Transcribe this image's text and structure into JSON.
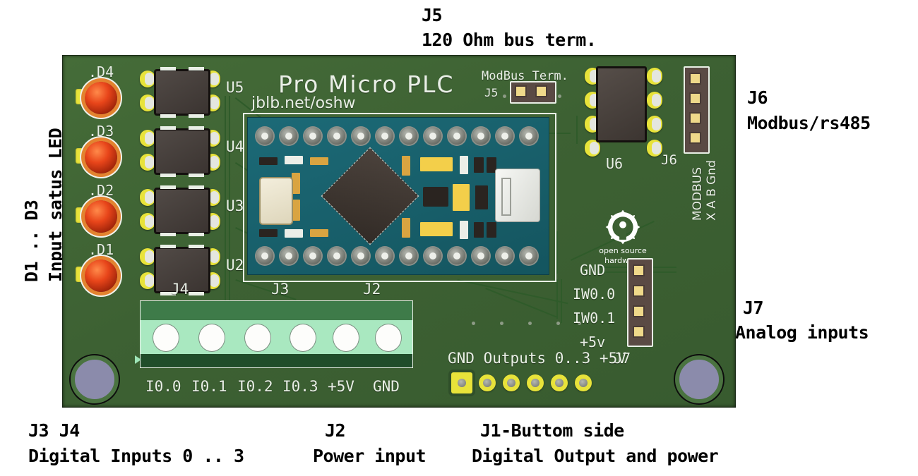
{
  "annotations": {
    "top": {
      "title": "J5",
      "desc": "120 Ohm bus term."
    },
    "left_vertical": {
      "line1": "D1 .. D3",
      "line2": "Input satus LED"
    },
    "right_top": {
      "title": "J6",
      "desc": "Modbus/rs485"
    },
    "right_bottom": {
      "title": "J7",
      "desc": "Analog inputs"
    },
    "bottom": {
      "j3j4_title": "J3 J4",
      "j3j4_desc": "Digital Inputs 0 .. 3",
      "j2_title": "J2",
      "j2_desc": "Power input",
      "j1_title": "J1-Buttom side",
      "j1_desc": "Digital Output and power"
    }
  },
  "board": {
    "brand": "Pro Micro PLC",
    "url": "jblb.net/oshw",
    "modbus_term_label": "ModBus Term.",
    "j5_label": "J5",
    "leds": [
      "#.D4",
      "#.D3",
      "#.D2",
      "#.D1"
    ],
    "led_labels": [
      ".D4",
      ".D3",
      ".D2",
      ".D1"
    ],
    "optos": [
      "U5",
      "U4",
      "U3",
      "U2"
    ],
    "ref_j4": "J4",
    "ref_j3": "J3",
    "ref_j2": "J2",
    "ref_u6": "U6",
    "ref_j6": "J6",
    "ref_j7": "J7",
    "modbus_vertical_line1": "MODBUS",
    "modbus_vertical_line2": "X A B Gnd",
    "j7_pins": [
      "GND",
      "IW0.0",
      "IW0.1",
      "+5v"
    ],
    "terminal_labels": [
      "I0.0",
      "I0.1",
      "I0.2",
      "I0.3",
      "+5V",
      "GND"
    ],
    "j1_label": "GND Outputs 0..3 +5V",
    "oshw_line1": "open source",
    "oshw_line2": "hardware"
  },
  "colors": {
    "pcb_green": "#3d6133",
    "silk_white": "#e9efe6",
    "pad_yellow": "#e8e33a",
    "led_red": "#e8451a",
    "promicro_teal": "#1c6a77",
    "terminal_green": "#a9e8c0",
    "annotation_black": "#000000"
  }
}
